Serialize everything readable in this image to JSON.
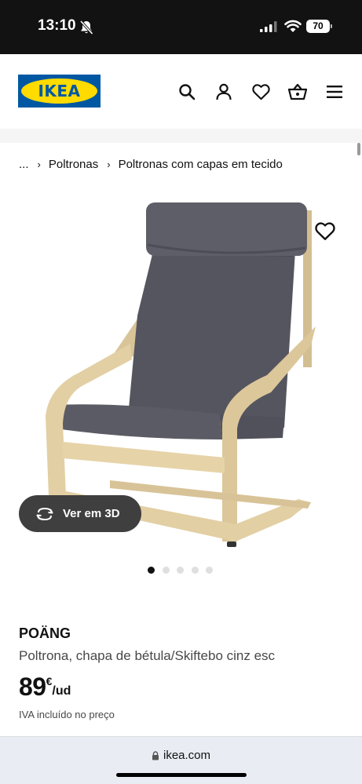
{
  "status_bar": {
    "time": "13:10",
    "battery": "70"
  },
  "header": {
    "logo_text": "IKEA"
  },
  "breadcrumb": {
    "ellipsis": "...",
    "items": [
      "Poltronas",
      "Poltronas com capas em tecido"
    ]
  },
  "gallery": {
    "view_3d_label": "Ver em 3D",
    "dot_count": 5,
    "active_dot": 0
  },
  "product": {
    "name": "POÄNG",
    "description": "Poltrona, chapa de bétula/Skiftebo cinz esc",
    "price_integer": "89",
    "currency": "€",
    "unit": "/ud",
    "vat_note": "IVA incluído no preço"
  },
  "browser": {
    "url": "ikea.com"
  },
  "colors": {
    "ikea_blue": "#0058a3",
    "ikea_yellow": "#ffdb00",
    "status_bar_bg": "#121212",
    "cushion_gray": "#55555f",
    "birch_wood": "#e2cfa3",
    "view3d_button_bg": "#3f3f3f"
  },
  "icons": [
    "bell-slash-icon",
    "signal-icon",
    "wifi-icon",
    "battery-icon",
    "search-icon",
    "user-icon",
    "heart-icon",
    "basket-icon",
    "menu-icon",
    "chevron-right-icon",
    "rotate-3d-icon",
    "lock-icon"
  ]
}
